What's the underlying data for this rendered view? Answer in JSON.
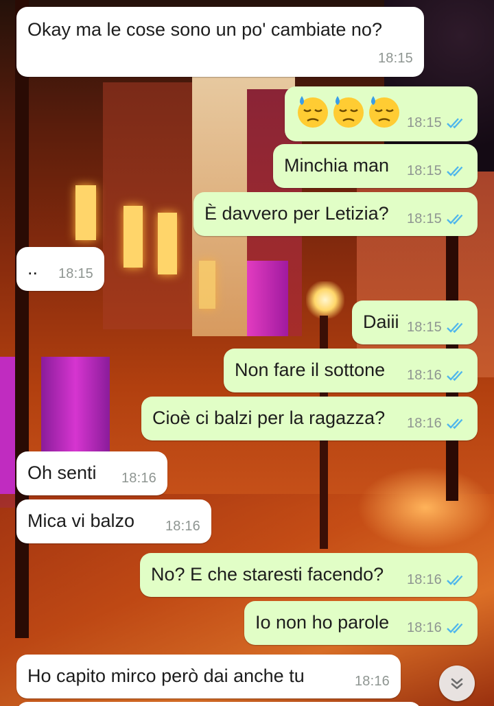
{
  "chat": {
    "messages": [
      {
        "dir": "in",
        "text": "Okay ma le cose sono un po' cambiate no?",
        "time": "18:15"
      },
      {
        "dir": "out",
        "emoji": [
          "downcast-face-with-sweat",
          "downcast-face-with-sweat",
          "downcast-face-with-sweat"
        ],
        "time": "18:15",
        "status": "read"
      },
      {
        "dir": "out",
        "text": "Minchia man",
        "time": "18:15",
        "status": "read"
      },
      {
        "dir": "out",
        "text": "È davvero per Letizia?",
        "time": "18:15",
        "status": "read"
      },
      {
        "dir": "in",
        "text": "..",
        "time": "18:15"
      },
      {
        "dir": "out",
        "text": "Daiii",
        "time": "18:15",
        "status": "read"
      },
      {
        "dir": "out",
        "text": "Non fare il sottone",
        "time": "18:16",
        "status": "read"
      },
      {
        "dir": "out",
        "text": "Cioè ci balzi per la ragazza?",
        "time": "18:16",
        "status": "read"
      },
      {
        "dir": "in",
        "text": "Oh senti",
        "time": "18:16"
      },
      {
        "dir": "in",
        "text": "Mica vi balzo",
        "time": "18:16"
      },
      {
        "dir": "out",
        "text": "No? E che staresti facendo?",
        "time": "18:16",
        "status": "read"
      },
      {
        "dir": "out",
        "text": "Io non ho parole",
        "time": "18:16",
        "status": "read"
      },
      {
        "dir": "in",
        "text": "Ho capito mirco però dai anche tu",
        "time": "18:16"
      }
    ]
  },
  "colors": {
    "incoming_bubble": "#ffffff",
    "outgoing_bubble": "#e1fec6",
    "read_ticks": "#4fb6ec",
    "timestamp": "#8e9591"
  },
  "icons": {
    "read_receipt": "double-check-icon",
    "scroll_down": "double-chevron-down-icon"
  }
}
